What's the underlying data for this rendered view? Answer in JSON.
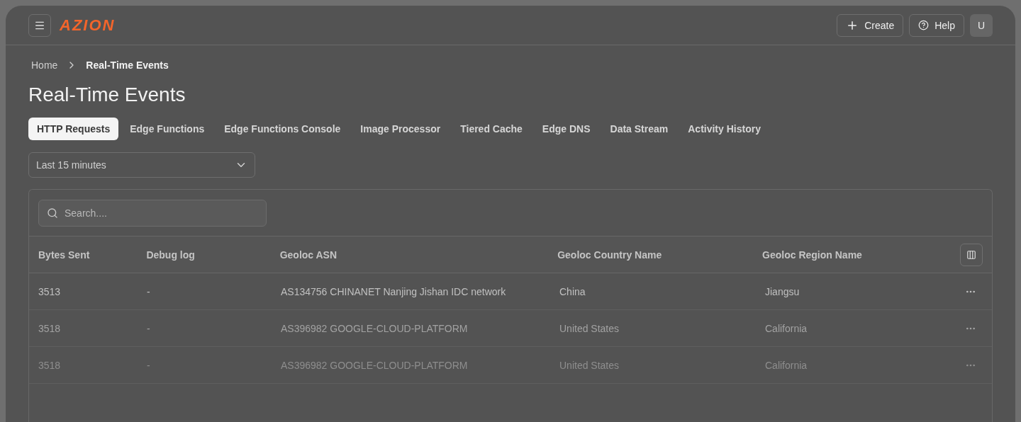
{
  "header": {
    "logo": "AZION",
    "buttons": [
      {
        "kind": "create",
        "label": "Create"
      },
      {
        "kind": "help",
        "label": "Help"
      }
    ],
    "avatar": "U"
  },
  "breadcrumb": [
    {
      "label": "Home",
      "current": false
    },
    {
      "label": "Real-Time Events",
      "current": true
    }
  ],
  "title": "Real-Time Events",
  "tabs": [
    {
      "label": "HTTP Requests",
      "selected": true
    },
    {
      "label": "Edge Functions",
      "selected": false
    },
    {
      "label": "Edge Functions Console",
      "selected": false
    },
    {
      "label": "Image Processor",
      "selected": false
    },
    {
      "label": "Tiered Cache",
      "selected": false
    },
    {
      "label": "Edge DNS",
      "selected": false
    },
    {
      "label": "Data Stream",
      "selected": false
    },
    {
      "label": "Activity History",
      "selected": false
    }
  ],
  "time_range": {
    "value": "Last 15 minutes"
  },
  "search": {
    "placeholder": "Search...."
  },
  "table": {
    "columns": [
      "Bytes Sent",
      "Debug log",
      "Geoloc ASN",
      "Geoloc Country Name",
      "Geoloc Region Name"
    ],
    "rows": [
      [
        "3513",
        "-",
        "AS134756 CHINANET Nanjing Jishan IDC network",
        "China",
        "Jiangsu"
      ],
      [
        "3518",
        "-",
        "AS396982 GOOGLE-CLOUD-PLATFORM",
        "United States",
        "California"
      ],
      [
        "3518",
        "-",
        "AS396982 GOOGLE-CLOUD-PLATFORM",
        "United States",
        "California"
      ]
    ]
  }
}
